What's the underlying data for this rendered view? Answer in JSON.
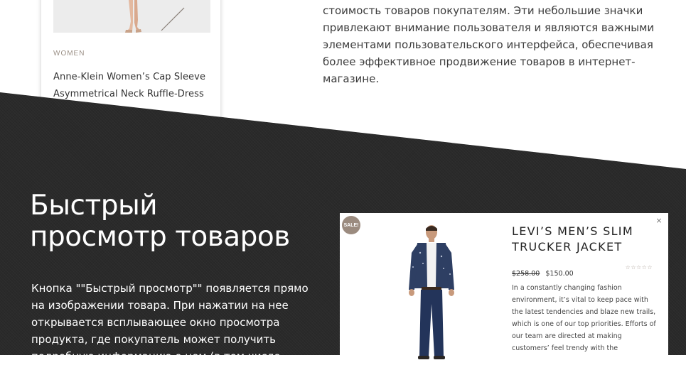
{
  "top_card": {
    "category": "WOMEN",
    "title": "Anne-Klein Women’s Cap Sleeve Asymmetrical Neck Ruffle-Dress"
  },
  "intro": {
    "text": "стоимость товаров покупателям. Эти небольшие значки привлекают внимание пользователя и являются важными элементами пользовательского интерфейса, обеспечивая более эффективное продвижение товаров в интернет-магазине."
  },
  "quick_view_section": {
    "heading_line1": "Быстрый",
    "heading_line2": "просмотр товаров",
    "text": "Кнопка \"\"Быстрый просмотр\"\" появляется прямо на изображении товара. При нажатии на нее открывается всплывающее окно просмотра продукта, где покупатель может получить подробную информацию о нем (в том числе"
  },
  "modal": {
    "sale_badge": "SALE!",
    "close_glyph": "×",
    "title": "LEVI’S MEN’S SLIM TRUCKER JACKET",
    "old_price": "$258.00",
    "new_price": "$150.00",
    "rating_glyph": "☆☆☆☆☆",
    "description": "In a constantly changing fashion environment, it’s vital to keep pace with the latest tendencies and blaze new trails, which is one of our top priorities. Efforts of our team are directed at making customers’ feel trendy with the"
  },
  "icons": {
    "close": "close-icon",
    "rating": "star-rating-icon",
    "sale": "sale-badge-icon"
  },
  "colors": {
    "dark_band": "#2a2a2a",
    "sale_badge": "#9b8b7f",
    "category": "#9a8f85"
  }
}
